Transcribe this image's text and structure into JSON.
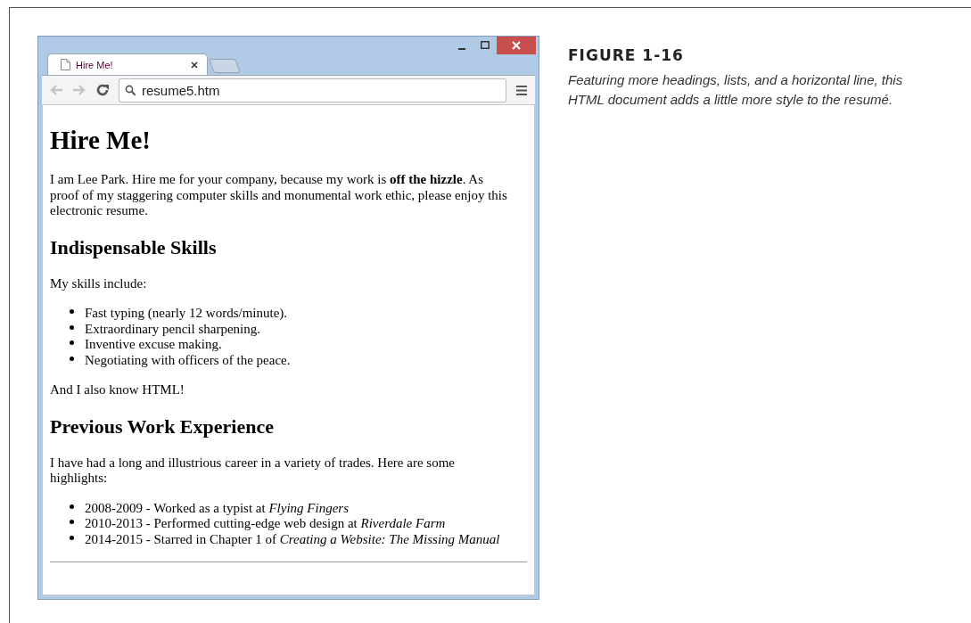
{
  "figure": {
    "label": "FIGURE 1-16",
    "caption": "Featuring more headings, lists, and a horizontal line, this HTML document adds a little more style to the resumé."
  },
  "browser": {
    "tabs": [
      {
        "title": "Hire Me!",
        "selected": true
      }
    ],
    "address": "resume5.htm",
    "page": [
      {
        "kind": "h1",
        "text": "Hire Me!"
      },
      {
        "kind": "p",
        "text": "I am Lee Park. Hire me for your company, because my work is **off the hizzle**. As proof of my staggering computer skills and monumental work ethic, please enjoy this electronic resume."
      },
      {
        "kind": "h2",
        "text": "Indispensable Skills"
      },
      {
        "kind": "p",
        "text": "My skills include:"
      },
      {
        "kind": "ul",
        "items": [
          "Fast typing (nearly 12 words/minute).",
          "Extraordinary pencil sharpening.",
          "Inventive excuse making.",
          "Negotiating with officers of the peace."
        ]
      },
      {
        "kind": "p",
        "text": "And I also know HTML!"
      },
      {
        "kind": "h2",
        "text": "Previous Work Experience"
      },
      {
        "kind": "p",
        "text": "I have had a long and illustrious career in a variety of trades. Here are some highlights:"
      },
      {
        "kind": "ul",
        "items": [
          "2008-2009 - Worked as a typist at *Flying Fingers*",
          "2010-2013 - Performed cutting-edge web design at *Riverdale Farm*",
          "2014-2015 - Starred in Chapter 1 of *Creating a Website: The Missing Manual*"
        ]
      },
      {
        "kind": "hr"
      }
    ]
  }
}
